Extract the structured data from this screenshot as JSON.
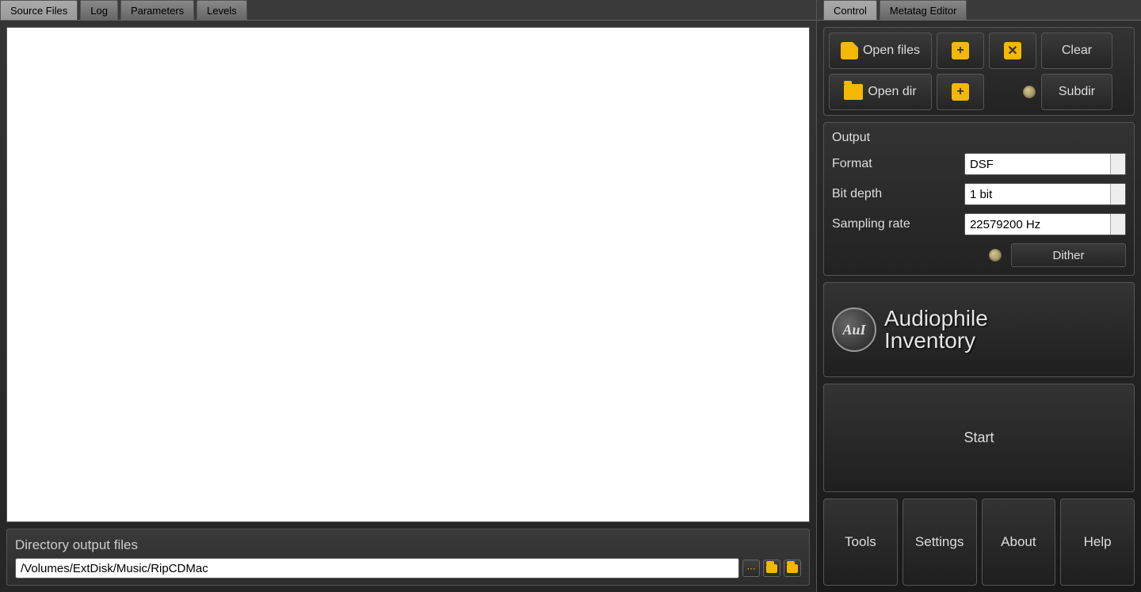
{
  "leftTabs": {
    "sourceFiles": "Source Files",
    "log": "Log",
    "parameters": "Parameters",
    "levels": "Levels"
  },
  "outputDir": {
    "label": "Directory output files",
    "path": "/Volumes/ExtDisk/Music/RipCDMac"
  },
  "rightTabs": {
    "control": "Control",
    "metatag": "Metatag Editor"
  },
  "controls": {
    "openFiles": "Open files",
    "openDir": "Open dir",
    "clear": "Clear",
    "subdir": "Subdir"
  },
  "output": {
    "title": "Output",
    "formatLabel": "Format",
    "formatValue": "DSF",
    "bitDepthLabel": "Bit depth",
    "bitDepthValue": "1 bit",
    "samplingLabel": "Sampling rate",
    "samplingValue": "22579200 Hz",
    "dither": "Dither"
  },
  "logo": {
    "badge": "AuI",
    "line1": "Audiophile",
    "line2": "Inventory"
  },
  "start": "Start",
  "bottom": {
    "tools": "Tools",
    "settings": "Settings",
    "about": "About",
    "help": "Help"
  }
}
